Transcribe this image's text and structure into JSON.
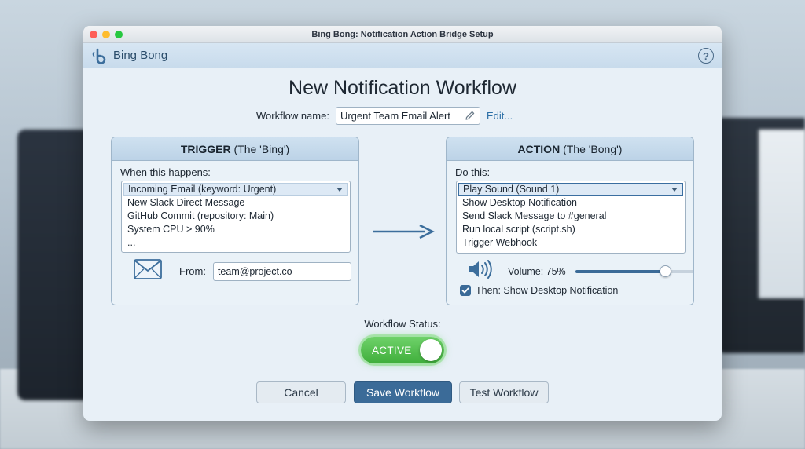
{
  "window": {
    "title": "Bing Bong: Notification Action Bridge Setup"
  },
  "app": {
    "name": "Bing Bong",
    "help_label": "?"
  },
  "page": {
    "title": "New Notification Workflow"
  },
  "workflow_name": {
    "label": "Workflow name:",
    "value": "Urgent Team Email Alert",
    "edit_link": "Edit..."
  },
  "trigger": {
    "header_bold": "TRIGGER",
    "header_rest": " (The 'Bing')",
    "sub_label": "When this happens:",
    "items": [
      "Incoming Email (keyword: Urgent)",
      "New Slack Direct Message",
      "GitHub Commit (repository: Main)",
      "System CPU > 90%",
      "..."
    ],
    "selected_index": 0,
    "from_label": "From:",
    "from_value": "team@project.co"
  },
  "action": {
    "header_bold": "ACTION",
    "header_rest": " (The 'Bong')",
    "sub_label": "Do this:",
    "items": [
      "Play Sound (Sound 1)",
      "Show Desktop Notification",
      "Send Slack Message to #general",
      "Run local script (script.sh)",
      "Trigger Webhook"
    ],
    "selected_index": 0,
    "volume_label": "Volume: 75%",
    "volume_percent": 75,
    "then_label": "Then: Show Desktop Notification",
    "then_checked": true
  },
  "status": {
    "label": "Workflow Status:",
    "toggle_text": "ACTIVE"
  },
  "buttons": {
    "cancel": "Cancel",
    "save": "Save Workflow",
    "test": "Test Workflow"
  },
  "colors": {
    "accent": "#3b6b98",
    "active_green": "#3fae3b"
  }
}
